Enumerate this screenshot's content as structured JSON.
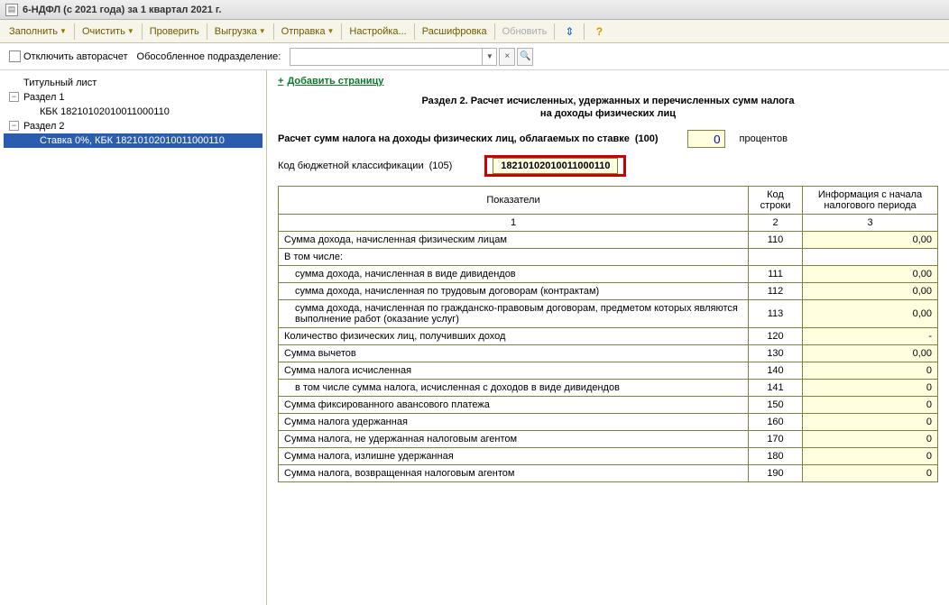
{
  "window": {
    "title": "6-НДФЛ (с 2021 года) за 1 квартал 2021 г."
  },
  "toolbar": {
    "fill": "Заполнить",
    "clear": "Очистить",
    "check": "Проверить",
    "export": "Выгрузка",
    "send": "Отправка",
    "settings": "Настройка...",
    "decode": "Расшифровка",
    "refresh": "Обновить"
  },
  "optionbar": {
    "disable_autocalc": "Отключить авторасчет",
    "subdivision_label": "Обособленное подразделение:"
  },
  "tree": {
    "title_page": "Титульный лист",
    "section1": "Раздел 1",
    "section1_kbk": "КБК 18210102010011000110",
    "section2": "Раздел 2",
    "section2_rate": "Ставка 0%, КБК 18210102010011000110"
  },
  "main": {
    "add_page": "Добавить страницу",
    "heading1": "Раздел 2. Расчет исчисленных, удержанных и перечисленных сумм налога",
    "heading2": "на доходы физических лиц",
    "rate_label": "Расчет сумм налога на доходы физических лиц, облагаемых по ставке",
    "rate_code": "(100)",
    "rate_value": "0",
    "rate_suffix": "процентов",
    "kbk_label": "Код бюджетной классификации",
    "kbk_code": "(105)",
    "kbk_value": "18210102010011000110",
    "headers": {
      "indicator": "Показатели",
      "line_code": "Код строки",
      "period_info": "Информация с начала налогового периода"
    },
    "colnums": {
      "c1": "1",
      "c2": "2",
      "c3": "3"
    },
    "rows": [
      {
        "label": "Сумма дохода, начисленная физическим лицам",
        "code": "110",
        "value": "0,00",
        "indent": false
      },
      {
        "label": "В том числе:",
        "code": "",
        "value": "",
        "indent": false
      },
      {
        "label": "сумма дохода, начисленная в виде дивидендов",
        "code": "111",
        "value": "0,00",
        "indent": true
      },
      {
        "label": "сумма дохода, начисленная по трудовым договорам (контрактам)",
        "code": "112",
        "value": "0,00",
        "indent": true
      },
      {
        "label": "сумма дохода, начисленная по гражданско-правовым договорам, предметом которых являются выполнение работ (оказание услуг)",
        "code": "113",
        "value": "0,00",
        "indent": true
      },
      {
        "label": "Количество физических лиц, получивших доход",
        "code": "120",
        "value": "-",
        "indent": false
      },
      {
        "label": "Сумма вычетов",
        "code": "130",
        "value": "0,00",
        "indent": false
      },
      {
        "label": "Сумма налога исчисленная",
        "code": "140",
        "value": "0",
        "indent": false
      },
      {
        "label": "в том числе сумма налога, исчисленная с доходов в виде дивидендов",
        "code": "141",
        "value": "0",
        "indent": true
      },
      {
        "label": "Сумма фиксированного авансового платежа",
        "code": "150",
        "value": "0",
        "indent": false
      },
      {
        "label": "Сумма налога удержанная",
        "code": "160",
        "value": "0",
        "indent": false
      },
      {
        "label": "Сумма налога, не удержанная налоговым агентом",
        "code": "170",
        "value": "0",
        "indent": false
      },
      {
        "label": "Сумма налога, излишне удержанная",
        "code": "180",
        "value": "0",
        "indent": false
      },
      {
        "label": "Сумма налога, возвращенная налоговым агентом",
        "code": "190",
        "value": "0",
        "indent": false
      }
    ]
  }
}
